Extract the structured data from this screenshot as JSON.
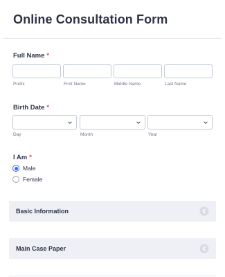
{
  "form": {
    "title": "Online Consultation Form"
  },
  "full_name": {
    "label": "Full Name",
    "required_mark": "*",
    "fields": [
      {
        "sublabel": "Prefix",
        "value": ""
      },
      {
        "sublabel": "First Name",
        "value": ""
      },
      {
        "sublabel": "Middle Name",
        "value": ""
      },
      {
        "sublabel": "Last Name",
        "value": ""
      }
    ]
  },
  "birth_date": {
    "label": "Birth Date",
    "required_mark": "*",
    "selects": [
      {
        "sublabel": "Day",
        "value": ""
      },
      {
        "sublabel": "Month",
        "value": ""
      },
      {
        "sublabel": "Year",
        "value": ""
      }
    ]
  },
  "gender": {
    "label": "I Am",
    "required_mark": "*",
    "options": [
      {
        "label": "Male",
        "selected": true
      },
      {
        "label": "Female",
        "selected": false
      }
    ]
  },
  "sections": [
    {
      "title": "Basic Information",
      "icon": "collapse-arrow-icon"
    },
    {
      "title": "Main Case Paper",
      "icon": "collapse-arrow-icon"
    }
  ],
  "colors": {
    "accent": "#2e69ff",
    "required": "#e04a59",
    "section_bg": "#eef0f5"
  }
}
